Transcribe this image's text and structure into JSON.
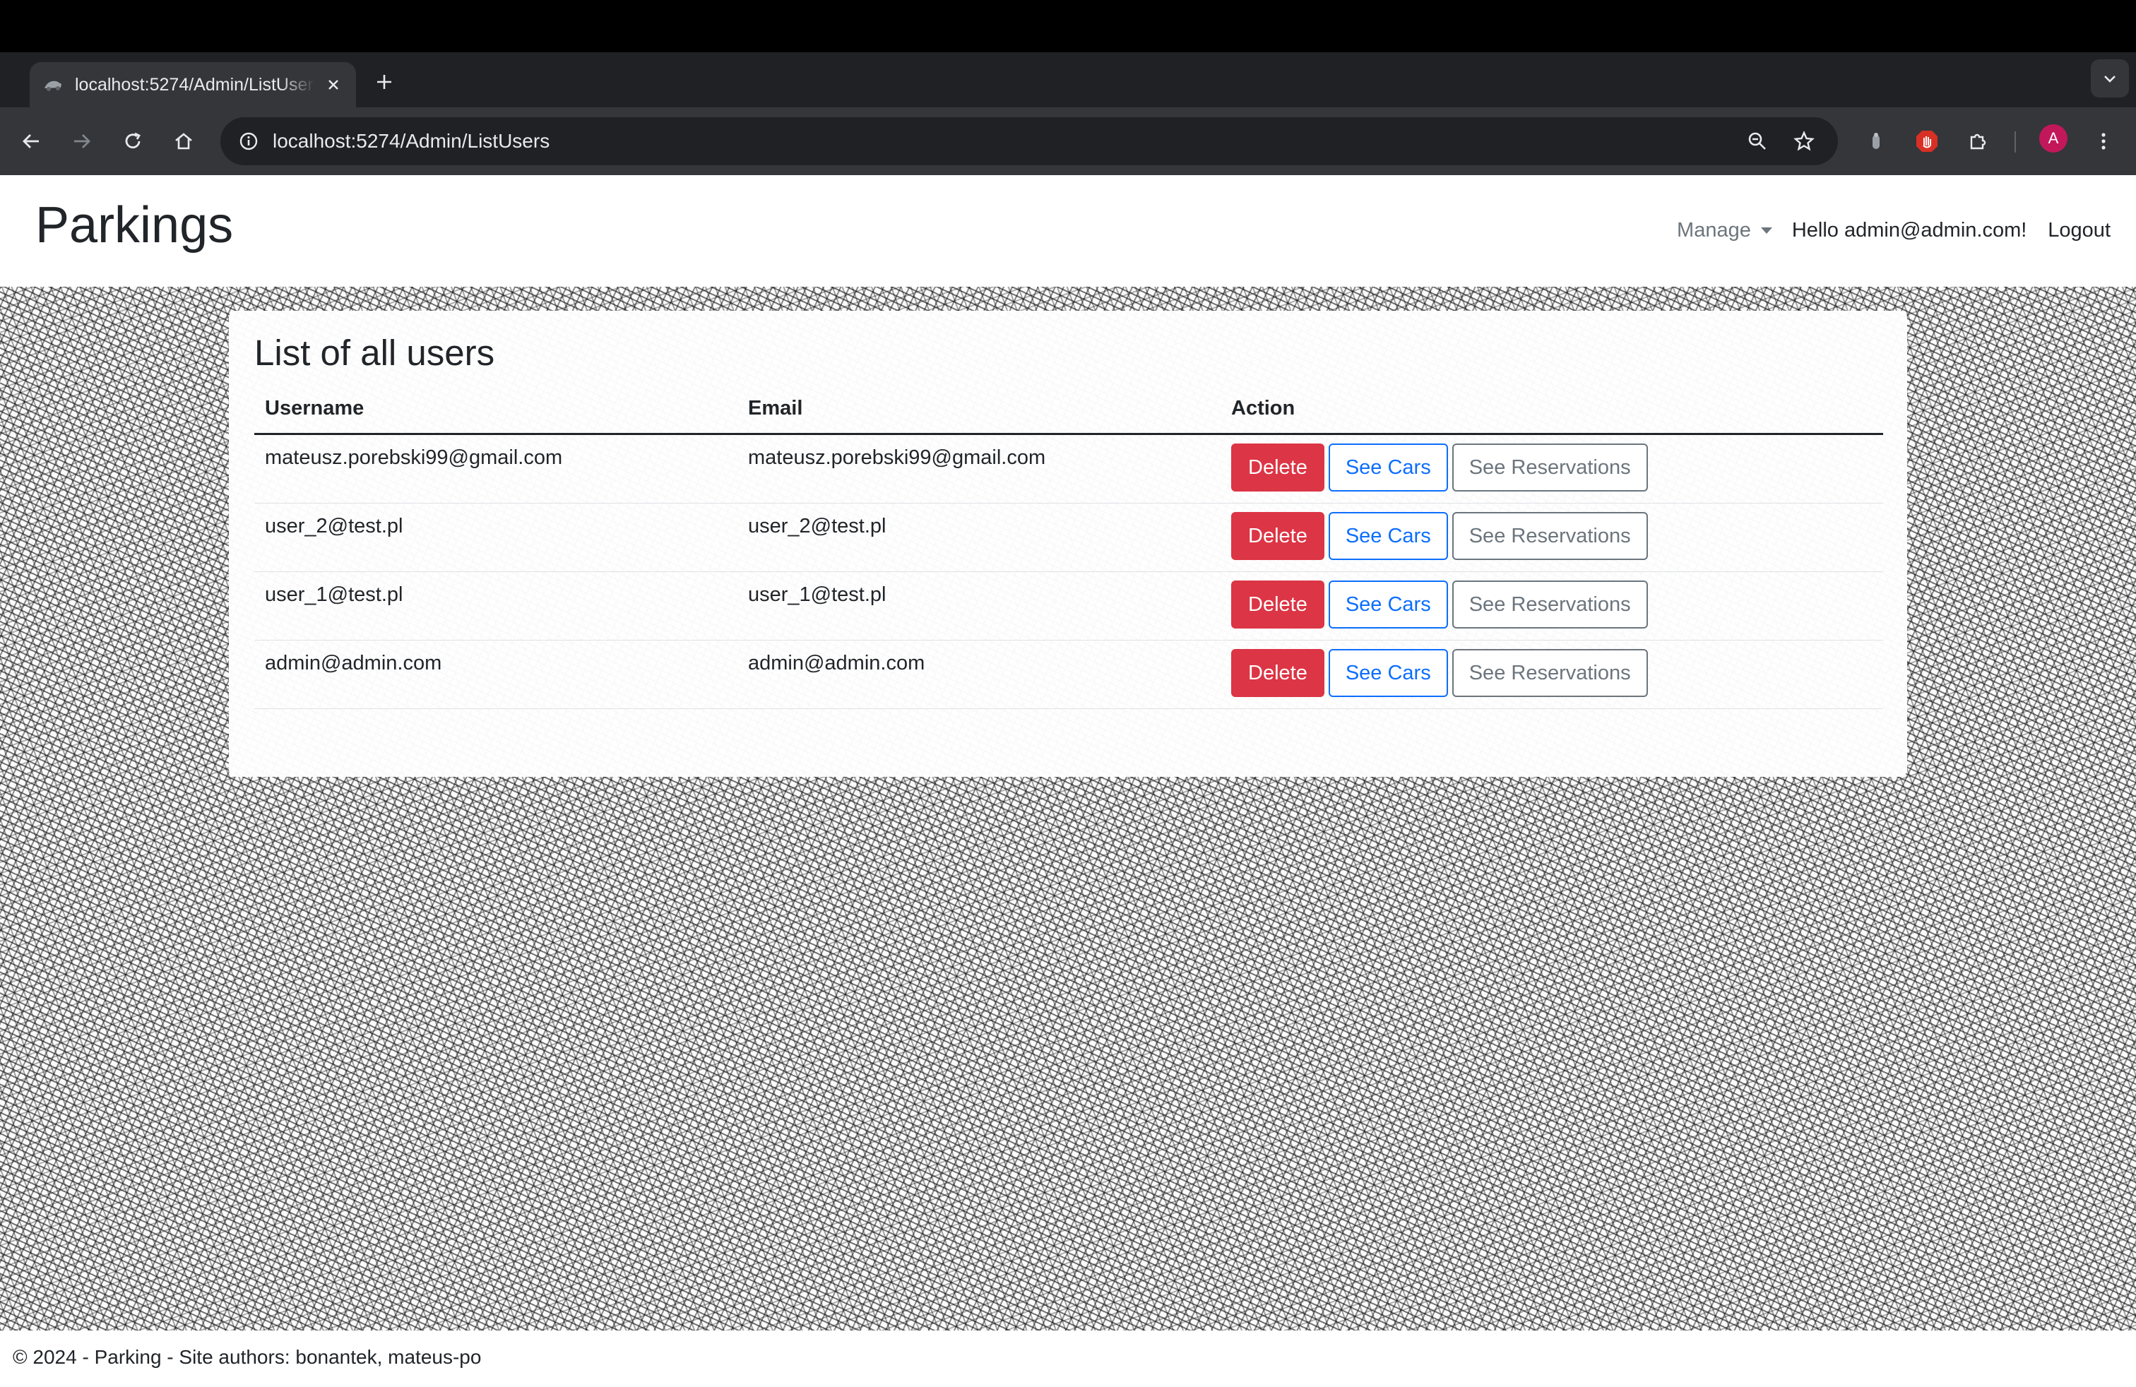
{
  "browser": {
    "tab_title": "localhost:5274/Admin/ListUsers",
    "url": "localhost:5274/Admin/ListUsers",
    "profile_initial": "A"
  },
  "site": {
    "brand": "Parkings",
    "nav": {
      "manage": "Manage",
      "greeting": "Hello admin@admin.com!",
      "logout": "Logout"
    }
  },
  "page": {
    "title": "List of all users",
    "columns": [
      "Username",
      "Email",
      "Action"
    ],
    "users": [
      {
        "username": "mateusz.porebski99@gmail.com",
        "email": "mateusz.porebski99@gmail.com"
      },
      {
        "username": "user_2@test.pl",
        "email": "user_2@test.pl"
      },
      {
        "username": "user_1@test.pl",
        "email": "user_1@test.pl"
      },
      {
        "username": "admin@admin.com",
        "email": "admin@admin.com"
      }
    ],
    "actions": {
      "delete": "Delete",
      "see_cars": "See Cars",
      "see_reservations": "See Reservations"
    }
  },
  "footer": {
    "text": "© 2024 - Parking - Site authors: bonantek, mateus-po"
  },
  "colors": {
    "danger": "#dc3545",
    "primary": "#0d6efd",
    "secondary": "#6c757d"
  }
}
